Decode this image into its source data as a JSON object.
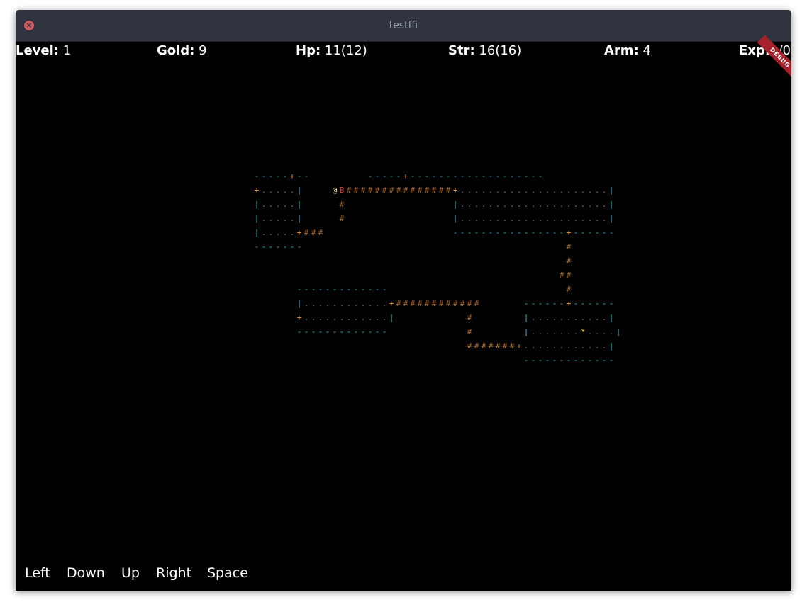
{
  "window": {
    "title": "testffi"
  },
  "stats": {
    "level_label": "Level:",
    "level_value": "1",
    "gold_label": "Gold:",
    "gold_value": "9",
    "hp_label": "Hp:",
    "hp_value": "11(12)",
    "str_label": "Str:",
    "str_value": "16(16)",
    "arm_label": "Arm:",
    "arm_value": "4",
    "exp_label": "Exp:",
    "exp_value": "1/0"
  },
  "debug_banner": "DEBUG",
  "controls": {
    "left": "Left",
    "down": "Down",
    "up": "Up",
    "right": "Right",
    "space": "Space"
  },
  "map": {
    "colors": {
      "wall": "#29c7d6",
      "floor": "#6e6e6e",
      "door": "#f0a030",
      "corridor": "#a86a2a",
      "player": "#f4e4b0",
      "monster": "#e04040",
      "item": "#f0d020"
    },
    "rows": [
      "-----+--        -----+-------------------",
      "+.....|    @B###############+.....................|",
      "|.....|     #               |.....................|",
      "|.....|     #               |.....................|",
      "|.....+###                  ----------------+------",
      "-------                                     #",
      "                                            #",
      "                                           ##",
      "      -------------                         #",
      "      |............+############      ------+------",
      "      +............|          #       |...........|",
      "      -------------           #       |.......*....|",
      "                              #######+............|",
      "                                      -------------"
    ]
  }
}
